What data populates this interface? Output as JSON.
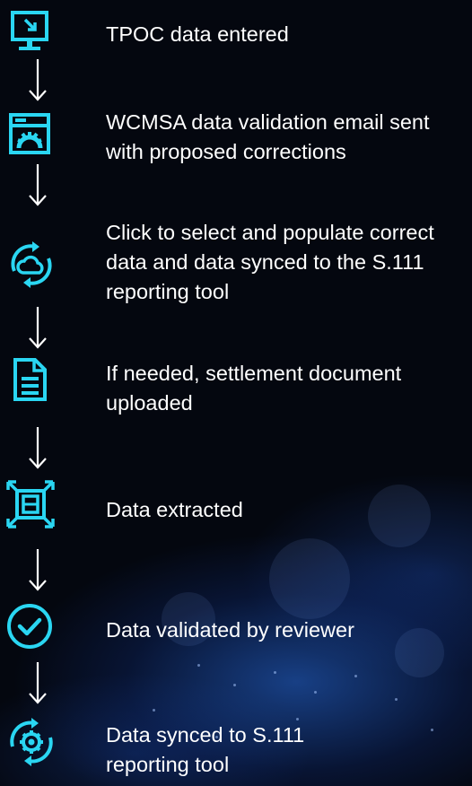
{
  "accent_color": "#2ad6f2",
  "steps": [
    {
      "icon": "monitor-download-icon",
      "text": "TPOC data entered"
    },
    {
      "icon": "browser-settings-icon",
      "text": "WCMSA data validation email sent with proposed corrections"
    },
    {
      "icon": "cloud-sync-icon",
      "text": "Click to select and populate correct data and data synced to the S.111 reporting tool"
    },
    {
      "icon": "document-icon",
      "text": "If needed, settlement document uploaded"
    },
    {
      "icon": "scan-extract-icon",
      "text": "Data extracted"
    },
    {
      "icon": "check-circle-icon",
      "text": "Data validated by reviewer"
    },
    {
      "icon": "gear-sync-icon",
      "text": "Data synced to S.111 reporting tool"
    }
  ]
}
